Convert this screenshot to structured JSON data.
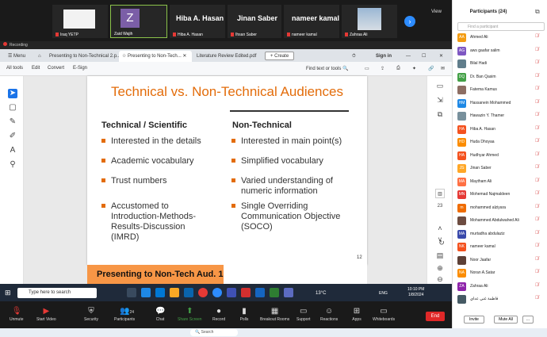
{
  "meeting": {
    "tiles": [
      {
        "name": "Iraq YETP"
      },
      {
        "name": "Zaid Wajih",
        "initial": "Z"
      },
      {
        "name": "Hiba A. Hasan",
        "display": "Hiba A. Hasan"
      },
      {
        "name": "Ihsan Saber",
        "display": "Jinan Saber"
      },
      {
        "name": "nameer kamal",
        "display": "nameer kamal"
      },
      {
        "name": "Zahraa Ali"
      }
    ],
    "view_label": "View",
    "recording_label": "Recording"
  },
  "browser": {
    "tabs": [
      "Menu",
      "Presenting to Non-Technical 2.p...",
      "Presenting to Non-Tech...",
      "Literature Review Edited.pdf",
      "Create"
    ],
    "sign_in": "Sign in",
    "toolbar": {
      "all_tools": "All tools",
      "edit": "Edit",
      "convert": "Convert",
      "esign": "E-Sign",
      "find": "Find text or tools"
    }
  },
  "slide": {
    "title": "Technical vs. Non-Technical Audiences",
    "left_heading": "Technical / Scientific",
    "right_heading": "Non-Technical",
    "left_bullets": [
      "Interested in the details",
      "Academic vocabulary",
      "Trust numbers",
      "Accustomed to\nIntroduction-Methods-\nResults-Discussion\n(IMRD)"
    ],
    "right_bullets": [
      "Interested in main point(s)",
      "Simplified vocabulary",
      "Varied understanding of\nnumeric information",
      "Single Overriding\nCommunication Objective\n(SOCO)"
    ],
    "page_number": "12",
    "next_title": "Presenting to Non-Tech Aud. 1",
    "page_indicator": "23"
  },
  "taskbar": {
    "search_placeholder": "Type here to search",
    "temperature": "13°C",
    "lang": "ENG",
    "time": "10:10 PM",
    "date": "1/8/2024"
  },
  "zoom_controls": {
    "items": [
      "Unmute",
      "Start Video",
      "Security",
      "Participants",
      "Chat",
      "Share Screen",
      "Record",
      "Polls",
      "Breakout Rooms",
      "Support",
      "Reactions",
      "Apps",
      "Whiteboards"
    ],
    "participants_count": "24",
    "end": "End"
  },
  "panel": {
    "title": "Participants (24)",
    "search_placeholder": "Find a participant",
    "participants": [
      {
        "name": "Ahmed Ali",
        "initials": "AA",
        "color": "#f39c12"
      },
      {
        "name": "aws gaafar salim",
        "initials": "AG",
        "color": "#7e57c2"
      },
      {
        "name": "Bilal Hadi",
        "initials": "",
        "color": "#607d8b"
      },
      {
        "name": "Dr. Ban Qasim",
        "initials": "DQ",
        "color": "#43a047"
      },
      {
        "name": "Fatema Kamus",
        "initials": "",
        "color": "#8d6e63"
      },
      {
        "name": "Hassanein Mohammed",
        "initials": "HM",
        "color": "#1e88e5"
      },
      {
        "name": "Hawazin Y. Thamer",
        "initials": "",
        "color": "#78909c"
      },
      {
        "name": "Hiba A. Hasan",
        "initials": "HA",
        "color": "#f4511e"
      },
      {
        "name": "Huda Dhoyaa",
        "initials": "HD",
        "color": "#fb8c00"
      },
      {
        "name": "Hudhyar Ahmed",
        "initials": "HA",
        "color": "#f4511e"
      },
      {
        "name": "Jinan Saber",
        "initials": "JS",
        "color": "#ffa726"
      },
      {
        "name": "Maytham Ali",
        "initials": "MA",
        "color": "#ff7043"
      },
      {
        "name": "Mohemad Najmaldeen",
        "initials": "MN",
        "color": "#e53935"
      },
      {
        "name": "mohammed alziyara",
        "initials": "m",
        "color": "#ef6c00"
      },
      {
        "name": "Mohammed Abdulwahed Ali",
        "initials": "",
        "color": "#6d4c41"
      },
      {
        "name": "murtadha abdulaziz",
        "initials": "MA",
        "color": "#3949ab"
      },
      {
        "name": "nameer kamal",
        "initials": "NK",
        "color": "#f4511e"
      },
      {
        "name": "Noor Jaafar",
        "initials": "",
        "color": "#5d4037"
      },
      {
        "name": "Noran A.Satar",
        "initials": "NA",
        "color": "#fb8c00"
      },
      {
        "name": "Zahraa Ali",
        "initials": "ZA",
        "color": "#8e24aa"
      },
      {
        "name": "فاطمة غني عداي",
        "initials": "",
        "color": "#455a64"
      }
    ],
    "invite": "Invite",
    "mute_all": "Mute All",
    "more": "..."
  }
}
